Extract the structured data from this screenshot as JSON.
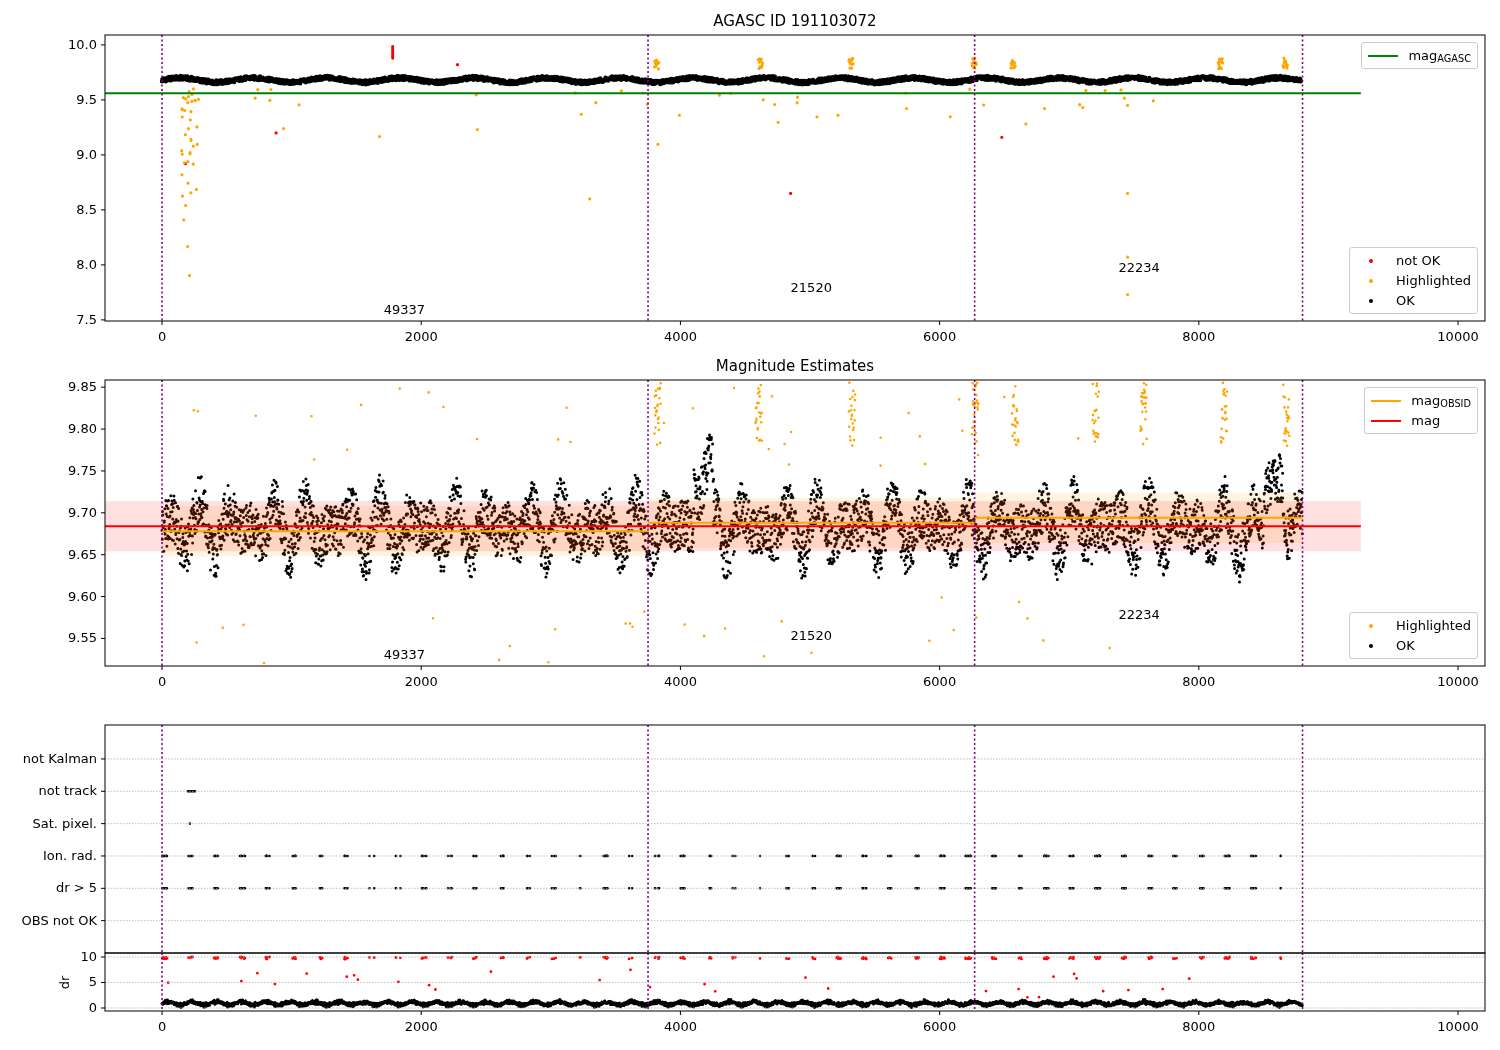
{
  "figure_title": "AGASC ID 191103072",
  "panels": [
    {
      "chart_data": {
        "type": "line",
        "xlim": [
          -440,
          10208
        ],
        "ylim": [
          7.49,
          10.09
        ],
        "xticks": [
          {
            "value": 0,
            "label": "0"
          },
          {
            "value": 2000,
            "label": "2000"
          },
          {
            "value": 4000,
            "label": "4000"
          },
          {
            "value": 6000,
            "label": "6000"
          },
          {
            "value": 8000,
            "label": "8000"
          },
          {
            "value": 10000,
            "label": "10000"
          }
        ],
        "yticks": [
          {
            "value": 7.5,
            "label": "7.5"
          },
          {
            "value": 8,
            "label": "8.0"
          },
          {
            "value": 8.5,
            "label": "8.5"
          },
          {
            "value": 9,
            "label": "9.0"
          },
          {
            "value": 9.5,
            "label": "9.5"
          },
          {
            "value": 10,
            "label": "10.0"
          }
        ],
        "series": [
          {
            "name": "mag$_{AGASC}$",
            "color": "#008000",
            "x": [
              -440,
              9250
            ],
            "values": [
              9.56,
              9.56
            ]
          }
        ],
        "ref_lines": [
          {
            "axis": "x",
            "value": 0,
            "color": "#800080"
          },
          {
            "axis": "x",
            "value": 3750,
            "color": "#800080"
          },
          {
            "axis": "x",
            "value": 6270,
            "color": "#800080"
          },
          {
            "axis": "x",
            "value": 8800,
            "color": "#800080"
          }
        ],
        "legend": "upper right",
        "annotations": [
          "49337",
          "21520",
          "22234"
        ]
      },
      "point_legend": [
        {
          "label": "not OK",
          "color": "#ff0000"
        },
        {
          "label": "Highlighted",
          "color": "#ffa500"
        },
        {
          "label": "OK",
          "color": "#000000"
        }
      ]
    },
    {
      "chart_data": {
        "type": "line",
        "title": "Magnitude Estimates",
        "xlim": [
          -440,
          10208
        ],
        "ylim": [
          9.5171,
          9.8586
        ],
        "xticks": [
          {
            "value": 0,
            "label": "0"
          },
          {
            "value": 2000,
            "label": "2000"
          },
          {
            "value": 4000,
            "label": "4000"
          },
          {
            "value": 6000,
            "label": "6000"
          },
          {
            "value": 8000,
            "label": "8000"
          },
          {
            "value": 10000,
            "label": "10000"
          }
        ],
        "yticks": [
          {
            "value": 9.55,
            "label": "9.55"
          },
          {
            "value": 9.6,
            "label": "9.60"
          },
          {
            "value": 9.65,
            "label": "9.65"
          },
          {
            "value": 9.7,
            "label": "9.70"
          },
          {
            "value": 9.75,
            "label": "9.75"
          },
          {
            "value": 9.8,
            "label": "9.80"
          },
          {
            "value": 9.85,
            "label": "9.85"
          }
        ],
        "series": [
          {
            "name": "mag$_{OBSID}$",
            "color": "#ffa500",
            "x": [
              0,
              3750,
              3750,
              6270,
              6270,
              8800
            ],
            "values": [
              9.678,
              9.678,
              9.688,
              9.688,
              9.694,
              9.694
            ]
          },
          {
            "name": "mag",
            "color": "#ff0000",
            "x": [
              -440,
              9250
            ],
            "values": [
              9.684,
              9.684
            ]
          }
        ],
        "bands": [
          {
            "axis": "y",
            "from": 9.648,
            "to": 9.708,
            "color": "#ffa500"
          },
          {
            "axis": "y",
            "from": 9.658,
            "to": 9.718,
            "color": "#ffa500"
          },
          {
            "axis": "y",
            "from": 9.664,
            "to": 9.724,
            "color": "#ffa500"
          },
          {
            "axis": "y",
            "from": 9.654,
            "to": 9.714,
            "color": "#ff0000"
          }
        ],
        "ref_lines": [
          {
            "axis": "x",
            "value": 0,
            "color": "#800080"
          },
          {
            "axis": "x",
            "value": 3750,
            "color": "#800080"
          },
          {
            "axis": "x",
            "value": 6270,
            "color": "#800080"
          },
          {
            "axis": "x",
            "value": 8800,
            "color": "#800080"
          }
        ],
        "legend": "upper right",
        "annotations": [
          "49337",
          "21520",
          "22234"
        ]
      },
      "point_legend": [
        {
          "label": "Highlighted",
          "color": "#ffa500"
        },
        {
          "label": "OK",
          "color": "#000000"
        }
      ]
    },
    {
      "chart_data": {
        "type": "scatter",
        "xlim": [
          -440,
          10208
        ],
        "categories": [
          "not Kalman",
          "not track",
          "Sat. pixel.",
          "Ion. rad.",
          "dr > 5",
          "OBS not OK"
        ],
        "orientation": "horizontal",
        "grid": true,
        "ref_lines": [
          {
            "axis": "x",
            "value": 0,
            "color": "#800080"
          },
          {
            "axis": "x",
            "value": 3750,
            "color": "#800080"
          },
          {
            "axis": "x",
            "value": 6270,
            "color": "#800080"
          },
          {
            "axis": "x",
            "value": 8800,
            "color": "#800080"
          }
        ]
      }
    },
    {
      "chart_data": {
        "type": "scatter",
        "xlim": [
          -440,
          10208
        ],
        "ylim": [
          -0.59,
          10.78
        ],
        "ylabel": "dr",
        "grid": true,
        "xticks": [
          {
            "value": 0,
            "label": "0"
          },
          {
            "value": 2000,
            "label": "2000"
          },
          {
            "value": 4000,
            "label": "4000"
          },
          {
            "value": 6000,
            "label": "6000"
          },
          {
            "value": 8000,
            "label": "8000"
          },
          {
            "value": 10000,
            "label": "10000"
          }
        ],
        "yticks": [
          {
            "value": 0,
            "label": "0"
          },
          {
            "value": 5,
            "label": "5"
          },
          {
            "value": 10,
            "label": "10"
          }
        ],
        "ref_lines": [
          {
            "axis": "x",
            "value": 0,
            "color": "#800080"
          },
          {
            "axis": "x",
            "value": 3750,
            "color": "#800080"
          },
          {
            "axis": "x",
            "value": 6270,
            "color": "#800080"
          },
          {
            "axis": "x",
            "value": 8800,
            "color": "#800080"
          }
        ]
      }
    }
  ]
}
